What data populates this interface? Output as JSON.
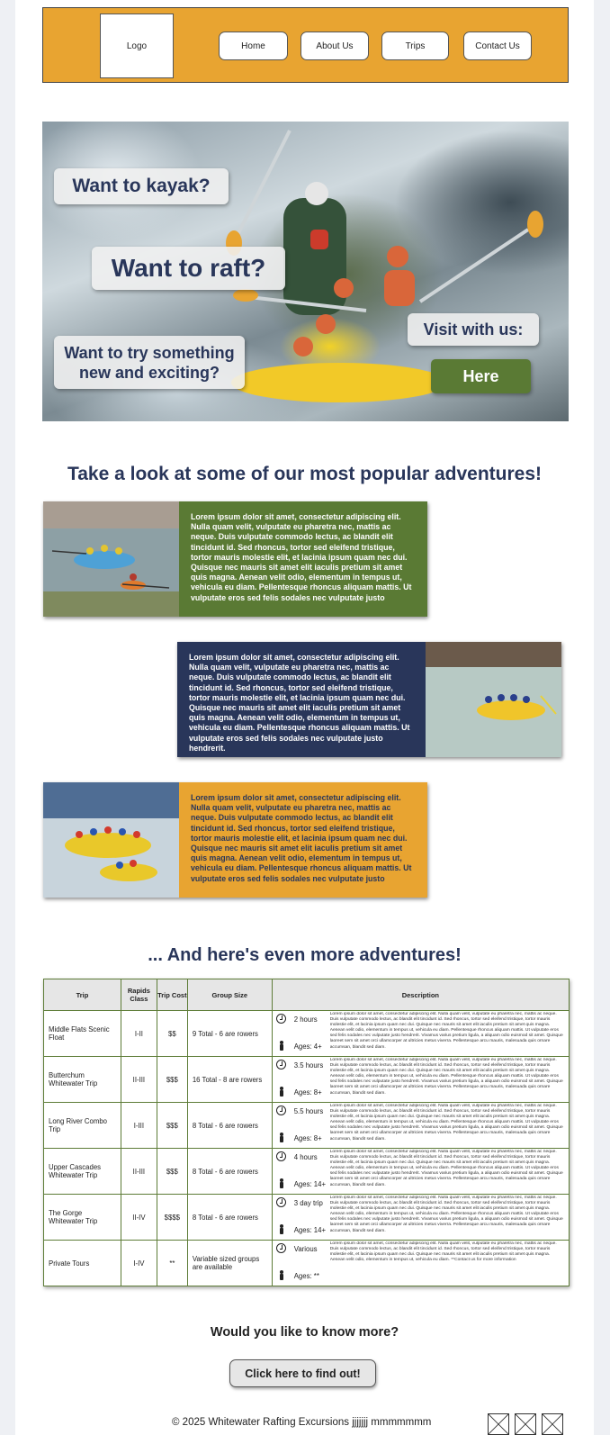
{
  "header": {
    "logo": "Logo",
    "nav": [
      "Home",
      "About Us",
      "Trips",
      "Contact Us"
    ],
    "accent": "#e8a431"
  },
  "hero": {
    "kayak": "Want to kayak?",
    "raft": "Want to raft?",
    "new": "Want to try something new and exciting?",
    "visit": "Visit with us:",
    "here": "Here"
  },
  "popular": {
    "title": "Take a look at some of our most popular adventures!",
    "cards": [
      {
        "text": "Lorem ipsum dolor sit amet, consectetur adipiscing elit. Nulla quam velit, vulputate eu pharetra nec, mattis ac neque. Duis vulputate commodo lectus, ac blandit elit tincidunt id. Sed rhoncus, tortor sed eleifend tristique, tortor mauris molestie elit, et lacinia ipsum quam nec dui. Quisque nec mauris sit amet elit iaculis pretium sit amet quis magna. Aenean velit odio, elementum in tempus ut, vehicula eu diam. Pellentesque rhoncus aliquam mattis. Ut vulputate eros sed felis sodales nec vulputate justo",
        "color": "#5a7a34"
      },
      {
        "text": "Lorem ipsum dolor sit amet, consectetur adipiscing elit. Nulla quam velit, vulputate eu pharetra nec, mattis ac neque. Duis vulputate commodo lectus, ac blandit elit tincidunt id. Sed rhoncus, tortor sed eleifend tristique, tortor mauris molestie elit, et lacinia ipsum quam nec dui. Quisque nec mauris sit amet elit iaculis pretium sit amet quis magna. Aenean velit odio, elementum in tempus ut, vehicula eu diam. Pellentesque rhoncus aliquam mattis. Ut vulputate eros sed felis sodales nec vulputate justo hendrerit.",
        "color": "#29365a"
      },
      {
        "text": "Lorem ipsum dolor sit amet, consectetur adipiscing elit. Nulla quam velit, vulputate eu pharetra nec, mattis ac neque. Duis vulputate commodo lectus, ac blandit elit tincidunt id. Sed rhoncus, tortor sed eleifend tristique, tortor mauris molestie elit, et lacinia ipsum quam nec dui. Quisque nec mauris sit amet elit iaculis pretium sit amet quis magna. Aenean velit odio, elementum in tempus ut, vehicula eu diam. Pellentesque rhoncus aliquam mattis. Ut vulputate eros sed felis sodales nec vulputate justo",
        "color": "#e8a431"
      }
    ]
  },
  "more": {
    "title": "... And here's even more adventures!",
    "headers": [
      "Trip",
      "Rapids Class",
      "Trip Cost",
      "Group Size",
      "Description"
    ],
    "rows": [
      {
        "trip": "Middle Flats Scenic Float",
        "rapids": "I-II",
        "cost": "$$",
        "group": "9 Total - 6 are rowers",
        "duration": "2 hours",
        "ages": "Ages: 4+",
        "desc": "Lorem ipsum dolor sit amet, consectetur adipiscing elit. Nulla quam velit, vulputate eu pharetra nec, mattis ac neque. Duis vulputate commodo lectus, ac blandit elit tincidunt id. Sed rhoncus, tortor sed eleifend tristique, tortor mauris molestie elit, et lacinia ipsum quam nec dui. Quisque nec mauris sit amet elit iaculis pretium sit amet quis magna. Aenean velit odio, elementum in tempus ut, vehicula eu diam. Pellentesque rhoncus aliquam mattis. Ut vulputate eros sed felis sodales nec vulputate justo hendrerit. Vivamus varius pretium ligula, a aliquam odio euismod sit amet. Quisque laoreet sem sit amet orci ullamcorper at ultricies metus viverra. Pellentesque arcu mauris, malesuada quis ornare accumsan, blandit sed diam."
      },
      {
        "trip": "Butterchum Whitewater Trip",
        "rapids": "II-III",
        "cost": "$$$",
        "group": "16 Total - 8 are rowers",
        "duration": "3.5 hours",
        "ages": "Ages: 8+",
        "desc": "Lorem ipsum dolor sit amet, consectetur adipiscing elit. Nulla quam velit, vulputate eu pharetra nec, mattis ac neque. Duis vulputate commodo lectus, ac blandit elit tincidunt id. Sed rhoncus, tortor sed eleifend tristique, tortor mauris molestie elit, et lacinia ipsum quam nec dui. Quisque nec mauris sit amet elit iaculis pretium sit amet quis magna. Aenean velit odio, elementum in tempus ut, vehicula eu diam. Pellentesque rhoncus aliquam mattis. Ut vulputate eros sed felis sodales nec vulputate justo hendrerit. Vivamus varius pretium ligula, a aliquam odio euismod sit amet. Quisque laoreet sem sit amet orci ullamcorper at ultricies metus viverra. Pellentesque arcu mauris, malesuada quis ornare accumsan, blandit sed diam."
      },
      {
        "trip": "Long River Combo Trip",
        "rapids": "I-III",
        "cost": "$$$",
        "group": "8 Total - 6 are rowers",
        "duration": "5.5 hours",
        "ages": "Ages: 8+",
        "desc": "Lorem ipsum dolor sit amet, consectetur adipiscing elit. Nulla quam velit, vulputate eu pharetra nec, mattis ac neque. Duis vulputate commodo lectus, ac blandit elit tincidunt id. Sed rhoncus, tortor sed eleifend tristique, tortor mauris molestie elit, et lacinia ipsum quam nec dui. Quisque nec mauris sit amet elit iaculis pretium sit amet quis magna. Aenean velit odio, elementum in tempus ut, vehicula eu diam. Pellentesque rhoncus aliquam mattis. Ut vulputate eros sed felis sodales nec vulputate justo hendrerit. Vivamus varius pretium ligula, a aliquam odio euismod sit amet. Quisque laoreet sem sit amet orci ullamcorper at ultricies metus viverra. Pellentesque arcu mauris, malesuada quis ornare accumsan, blandit sed diam."
      },
      {
        "trip": "Upper Cascades Whitewater Trip",
        "rapids": "II-III",
        "cost": "$$$",
        "group": "8 Total - 6 are rowers",
        "duration": "4 hours",
        "ages": "Ages: 14+",
        "desc": "Lorem ipsum dolor sit amet, consectetur adipiscing elit. Nulla quam velit, vulputate eu pharetra nec, mattis ac neque. Duis vulputate commodo lectus, ac blandit elit tincidunt id. Sed rhoncus, tortor sed eleifend tristique, tortor mauris molestie elit, et lacinia ipsum quam nec dui. Quisque nec mauris sit amet elit iaculis pretium sit amet quis magna. Aenean velit odio, elementum in tempus ut, vehicula eu diam. Pellentesque rhoncus aliquam mattis. Ut vulputate eros sed felis sodales nec vulputate justo hendrerit. Vivamus varius pretium ligula, a aliquam odio euismod sit amet. Quisque laoreet sem sit amet orci ullamcorper at ultricies metus viverra. Pellentesque arcu mauris, malesuada quis ornare accumsan, blandit sed diam."
      },
      {
        "trip": "The Gorge Whitewater Trip",
        "rapids": "II-IV",
        "cost": "$$$$",
        "group": "8 Total - 6 are rowers",
        "duration": "3 day trip",
        "ages": "Ages: 14+",
        "desc": "Lorem ipsum dolor sit amet, consectetur adipiscing elit. Nulla quam velit, vulputate eu pharetra nec, mattis ac neque. Duis vulputate commodo lectus, ac blandit elit tincidunt id. Sed rhoncus, tortor sed eleifend tristique, tortor mauris molestie elit, et lacinia ipsum quam nec dui. Quisque nec mauris sit amet elit iaculis pretium sit amet quis magna. Aenean velit odio, elementum in tempus ut, vehicula eu diam. Pellentesque rhoncus aliquam mattis. Ut vulputate eros sed felis sodales nec vulputate justo hendrerit. Vivamus varius pretium ligula, a aliquam odio euismod sit amet. Quisque laoreet sem sit amet orci ullamcorper at ultricies metus viverra. Pellentesque arcu mauris, malesuada quis ornare accumsan, blandit sed diam."
      },
      {
        "trip": "Private Tours",
        "rapids": "I-IV",
        "cost": "**",
        "group": "Variable sized groups are available",
        "duration": "Various",
        "ages": "Ages: **",
        "desc": "Lorem ipsum dolor sit amet, consectetur adipiscing elit. Nulla quam velit, vulputate eu pharetra nec, mattis ac neque. Duis vulputate commodo lectus, ac blandit elit tincidunt id. Sed rhoncus, tortor sed eleifend tristique, tortor mauris molestie elit, et lacinia ipsum quam nec dui. Quisque nec mauris sit amet elit iaculis pretium sit amet quis magna. Aenean velit odio, elementum in tempus ut, vehicula eu diam. **Contact us for more information"
      }
    ]
  },
  "cta": {
    "question": "Would you like to know more?",
    "button": "Click here to find out!"
  },
  "footer": {
    "text": "© 2025  Whitewater Rafting Excursions jjjjjjj mmmmmmm"
  }
}
